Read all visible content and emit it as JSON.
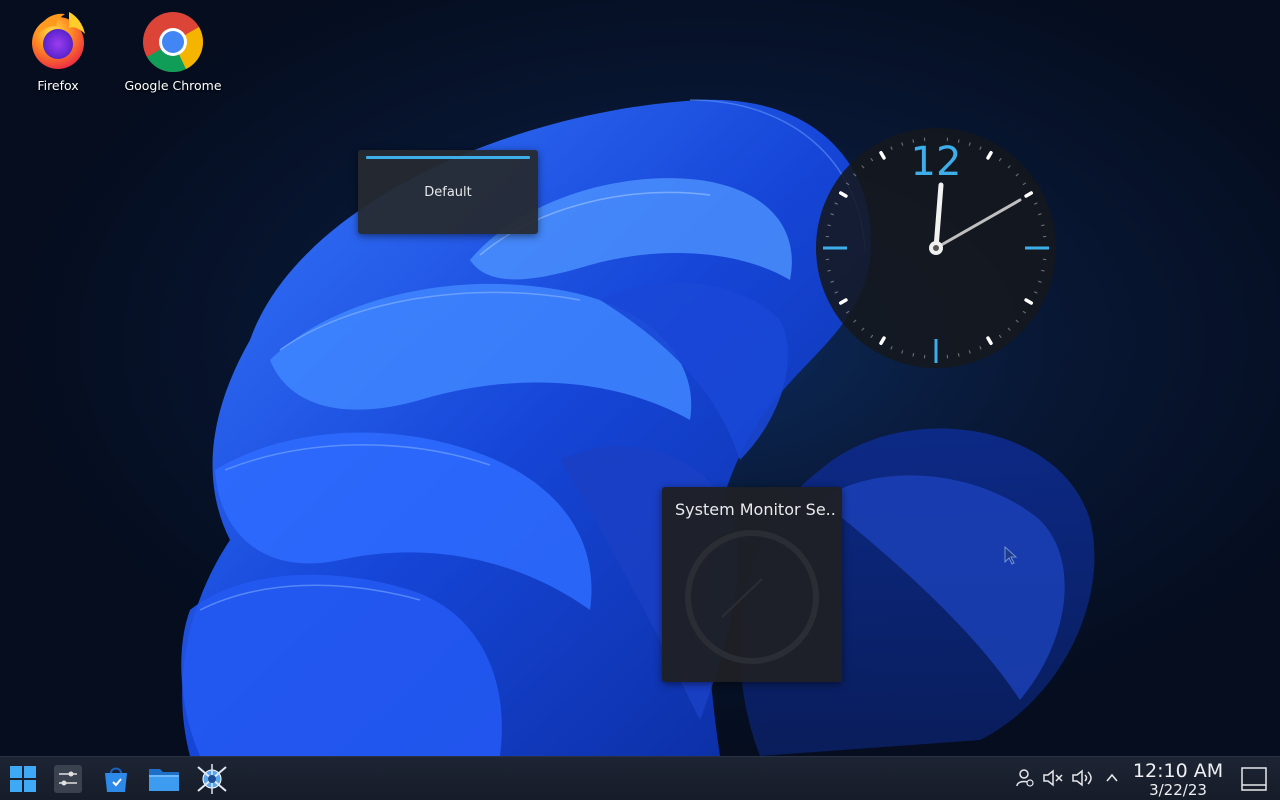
{
  "desktop": {
    "icons": [
      {
        "label": "Firefox",
        "icon": "firefox-icon"
      },
      {
        "label": "Google Chrome",
        "icon": "chrome-icon"
      }
    ]
  },
  "widgets": {
    "activity": {
      "label": "Default",
      "accent": "#3daee9"
    },
    "clock": {
      "numeral": "12",
      "accent": "#3daee9"
    },
    "system_monitor": {
      "title": "System Monitor Se..."
    }
  },
  "taskbar": {
    "launchers": [
      {
        "name": "start-menu",
        "icon": "windows-logo-icon"
      },
      {
        "name": "settings",
        "icon": "sliders-icon"
      },
      {
        "name": "software-store",
        "icon": "store-bag-icon"
      },
      {
        "name": "file-manager",
        "icon": "folder-icon"
      },
      {
        "name": "network-tool",
        "icon": "network-globe-icon"
      }
    ],
    "tray": {
      "icons": [
        "user-icon",
        "mute-icon",
        "volume-icon",
        "chevron-up-icon"
      ],
      "time": "12:10 AM",
      "date": "3/22/23"
    }
  },
  "colors": {
    "accent": "#3daee9",
    "taskbar": "#1a2130",
    "wallpaper_blue": "#1f4fe0"
  }
}
